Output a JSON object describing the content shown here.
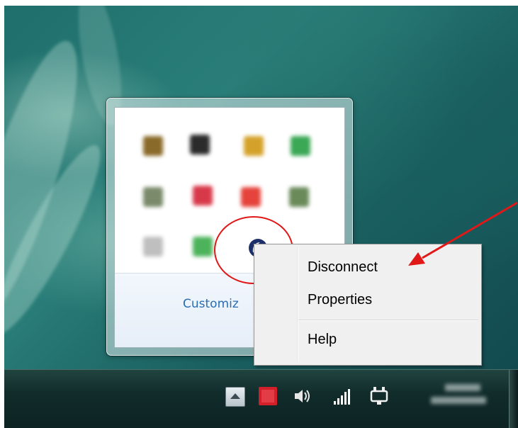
{
  "tray": {
    "customize_label": "Customiz",
    "icons": [
      {
        "name": "tray-app-icon-1",
        "color": "#8a6a2a"
      },
      {
        "name": "tray-app-icon-2",
        "color": "#2b2b2b"
      },
      {
        "name": "tray-app-icon-3",
        "color": "#d4a22a"
      },
      {
        "name": "tray-app-icon-4",
        "color": "#3aa855"
      },
      {
        "name": "tray-app-icon-5",
        "color": "#7a8a6a"
      },
      {
        "name": "tray-app-icon-6",
        "color": "#d8394a"
      },
      {
        "name": "tray-app-icon-7",
        "color": "#e5433b"
      },
      {
        "name": "tray-app-icon-8",
        "color": "#6a8a5a"
      },
      {
        "name": "tray-app-icon-9",
        "color": "#bfbfbf"
      },
      {
        "name": "tray-app-icon-10",
        "color": "#4db35a"
      }
    ],
    "highlighted_icon": "vpn-connection-icon"
  },
  "context_menu": {
    "items": [
      {
        "label": "Disconnect"
      },
      {
        "label": "Properties"
      },
      {
        "label": "Help"
      }
    ]
  },
  "annotation": {
    "circle_color": "#e01818",
    "arrow_color": "#e01818"
  },
  "taskbar": {
    "icons": [
      {
        "name": "show-hidden-icons-button"
      },
      {
        "name": "red-app-tray-icon",
        "color": "#d21f2a"
      },
      {
        "name": "speaker-icon"
      },
      {
        "name": "signal-strength-icon"
      },
      {
        "name": "power-plug-icon"
      }
    ]
  }
}
